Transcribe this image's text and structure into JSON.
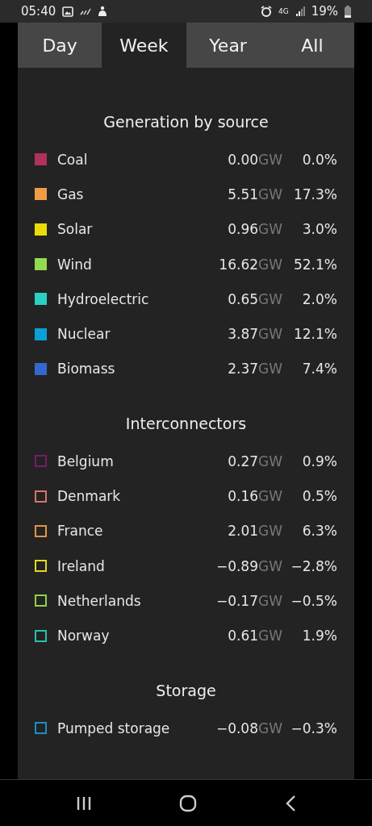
{
  "status_bar": {
    "time": "05:40",
    "network": "4G",
    "battery": "19%"
  },
  "tabs": [
    {
      "label": "Day",
      "selected": false
    },
    {
      "label": "Week",
      "selected": true
    },
    {
      "label": "Year",
      "selected": false
    },
    {
      "label": "All",
      "selected": false
    }
  ],
  "sections": [
    {
      "title": "Generation by source",
      "items": [
        {
          "name": "Coal",
          "kind": "filled",
          "color": "#b0315a",
          "value": "0.00",
          "unit": "GW",
          "share": "0.0%"
        },
        {
          "name": "Gas",
          "kind": "filled",
          "color": "#f29b45",
          "value": "5.51",
          "unit": "GW",
          "share": "17.3%"
        },
        {
          "name": "Solar",
          "kind": "filled",
          "color": "#ecdc06",
          "value": "0.96",
          "unit": "GW",
          "share": "3.0%"
        },
        {
          "name": "Wind",
          "kind": "filled",
          "color": "#93db4e",
          "value": "16.62",
          "unit": "GW",
          "share": "52.1%"
        },
        {
          "name": "Hydroelectric",
          "kind": "filled",
          "color": "#2ad1c0",
          "value": "0.65",
          "unit": "GW",
          "share": "2.0%"
        },
        {
          "name": "Nuclear",
          "kind": "filled",
          "color": "#0b9fd8",
          "value": "3.87",
          "unit": "GW",
          "share": "12.1%"
        },
        {
          "name": "Biomass",
          "kind": "filled",
          "color": "#3468cf",
          "value": "2.37",
          "unit": "GW",
          "share": "7.4%"
        }
      ]
    },
    {
      "title": "Interconnectors",
      "items": [
        {
          "name": "Belgium",
          "kind": "outline",
          "color": "#7a1a6a",
          "value": "0.27",
          "unit": "GW",
          "share": "0.9%"
        },
        {
          "name": "Denmark",
          "kind": "outline",
          "color": "#d5726e",
          "value": "0.16",
          "unit": "GW",
          "share": "0.5%"
        },
        {
          "name": "France",
          "kind": "outline",
          "color": "#e59345",
          "value": "2.01",
          "unit": "GW",
          "share": "6.3%"
        },
        {
          "name": "Ireland",
          "kind": "outline",
          "color": "#e6d81a",
          "value": "−0.89",
          "unit": "GW",
          "share": "−2.8%"
        },
        {
          "name": "Netherlands",
          "kind": "outline",
          "color": "#8fd14a",
          "value": "−0.17",
          "unit": "GW",
          "share": "−0.5%"
        },
        {
          "name": "Norway",
          "kind": "outline",
          "color": "#2abfb0",
          "value": "0.61",
          "unit": "GW",
          "share": "1.9%"
        }
      ]
    },
    {
      "title": "Storage",
      "items": [
        {
          "name": "Pumped storage",
          "kind": "outline",
          "color": "#1a8fc0",
          "value": "−0.08",
          "unit": "GW",
          "share": "−0.3%"
        }
      ]
    }
  ]
}
